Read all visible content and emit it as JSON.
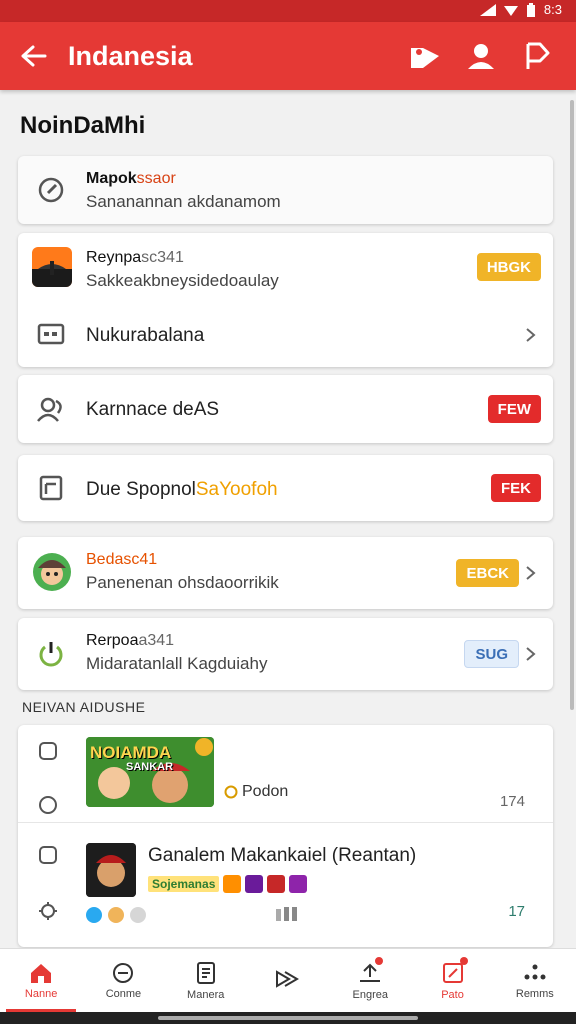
{
  "status": {
    "time": "8:3"
  },
  "appbar": {
    "title": "Indanesia"
  },
  "heading": "NoinDaMhi",
  "card1": {
    "title": "Mapok",
    "title_accent": "ssaor",
    "subtitle": "Sananannan akdanamom"
  },
  "card2": {
    "row1": {
      "title": "Reynpa",
      "title_accent": "sc341",
      "subtitle": "Sakkeakbneysidedoaulay",
      "badge": "HBGK"
    },
    "row2": {
      "label": "Nukurabalana"
    }
  },
  "card3": {
    "label": "Karnnace deAS",
    "badge": "FEW"
  },
  "card4": {
    "label": "Due Spopnol",
    "label_accent": "SaYoofoh",
    "badge": "FEK"
  },
  "card5": {
    "title": "Bedasc41",
    "subtitle": "Panenenan ohsdaoorrikik",
    "badge": "EBCK"
  },
  "card6": {
    "title": "Rerpoa",
    "title_accent": "a341",
    "subtitle": "Midaratanlall Kagduiahy",
    "badge": "SUG"
  },
  "section": {
    "label": "NEIVAN AIDUSHE"
  },
  "list": {
    "item1": {
      "thumb_text": "NOIAMDA",
      "thumb_sub": "SANKAR",
      "tag": "Podon",
      "count": "174"
    },
    "item2": {
      "title": "Ganalem Makankaiel (Reantan)",
      "chip_text": "Sojemanas",
      "count": "17"
    }
  },
  "colors": {
    "primary": "#e53935",
    "badge_yellow": "#f0b428",
    "badge_red": "#e32b2b",
    "badge_blue": "#e3eefb"
  },
  "nav": [
    {
      "label": "Nanne",
      "icon": "home-icon"
    },
    {
      "label": "Conme",
      "icon": "circle-minus-icon"
    },
    {
      "label": "Manera",
      "icon": "document-icon"
    },
    {
      "label": "",
      "icon": "share-icon"
    },
    {
      "label": "Engrea",
      "icon": "upload-icon"
    },
    {
      "label": "Pato",
      "icon": "edit-icon"
    },
    {
      "label": "Remms",
      "icon": "grid-dots-icon"
    }
  ]
}
